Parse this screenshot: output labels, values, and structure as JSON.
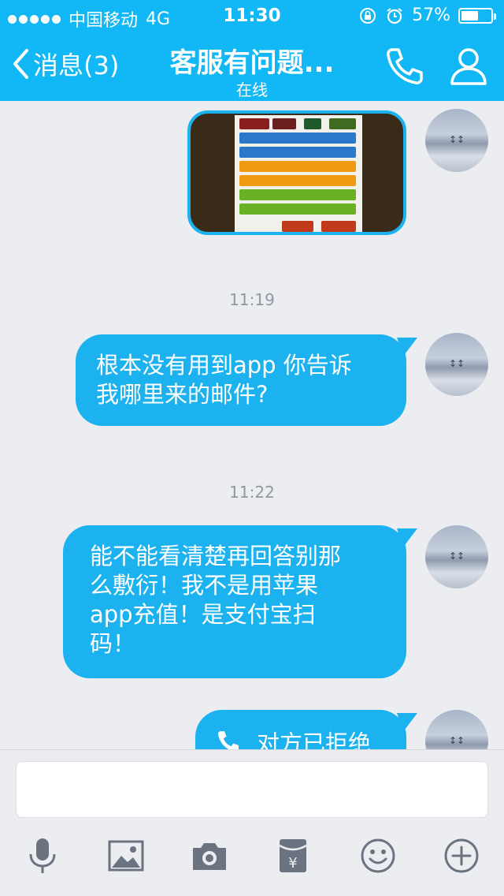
{
  "status_bar": {
    "carrier": "中国移动",
    "network": "4G",
    "time": "11:30",
    "battery": "57%",
    "battery_level": 0.57
  },
  "nav": {
    "back_label": "消息(3)",
    "title": "客服有问题...",
    "subtitle": "在线"
  },
  "chat": {
    "timestamps": [
      "11:19",
      "11:22"
    ],
    "messages": [
      {
        "type": "image",
        "sender": "self"
      },
      {
        "type": "text",
        "sender": "self",
        "text_lines": [
          "根本没有用到app 你告诉",
          "我哪里来的邮件?"
        ]
      },
      {
        "type": "text",
        "sender": "self",
        "text_lines": [
          "能不能看清楚再回答别那",
          "么敷衍！我不是用苹果",
          "app充值！是支付宝扫",
          "码！"
        ]
      },
      {
        "type": "call",
        "sender": "self",
        "text": "对方已拒绝"
      }
    ]
  },
  "input": {
    "placeholder": "",
    "value": ""
  },
  "toolbar": {
    "icons": [
      "microphone-icon",
      "image-icon",
      "camera-icon",
      "red-packet-icon",
      "emoji-icon",
      "plus-icon"
    ]
  },
  "colors": {
    "accent": "#12b7f5",
    "bubble": "#1cb2f0",
    "background": "#ebedf1"
  }
}
